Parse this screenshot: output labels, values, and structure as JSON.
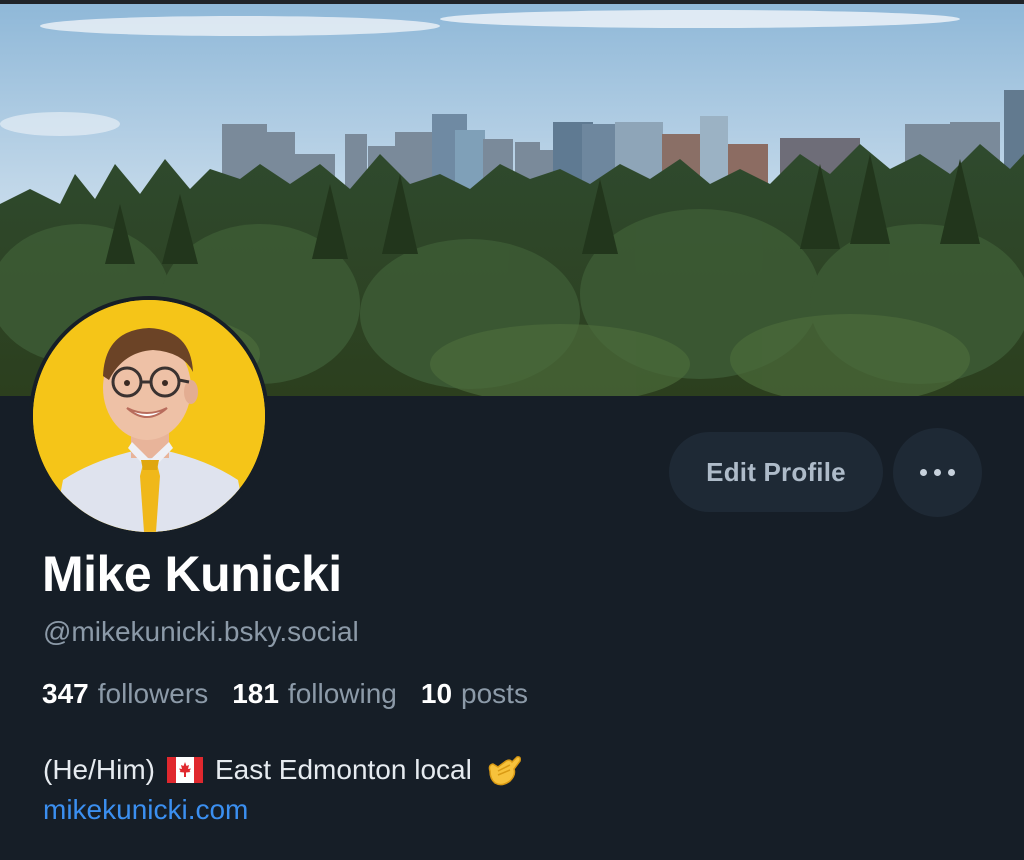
{
  "profile": {
    "display_name": "Mike Kunicki",
    "handle": "@mikekunicki.bsky.social",
    "followers_count": "347",
    "followers_label": "followers",
    "following_count": "181",
    "following_label": "following",
    "posts_count": "10",
    "posts_label": "posts",
    "bio_prefix": "(He/Him)",
    "bio_flag_icon": "canada-flag-icon",
    "bio_text": "East Edmonton local",
    "bio_hand_icon": "call-me-hand-icon",
    "website": "mikekunicki.com"
  },
  "actions": {
    "edit_profile_label": "Edit Profile",
    "more_icon": "more-horizontal-icon"
  },
  "media": {
    "banner": "city-skyline-forest-banner",
    "avatar": "profile-photo-avatar"
  },
  "colors": {
    "background": "#161e27",
    "button_bg": "#1e2935",
    "link": "#3b8ff0",
    "muted_text": "#8c9aa8",
    "avatar_bg": "#f5c518"
  }
}
